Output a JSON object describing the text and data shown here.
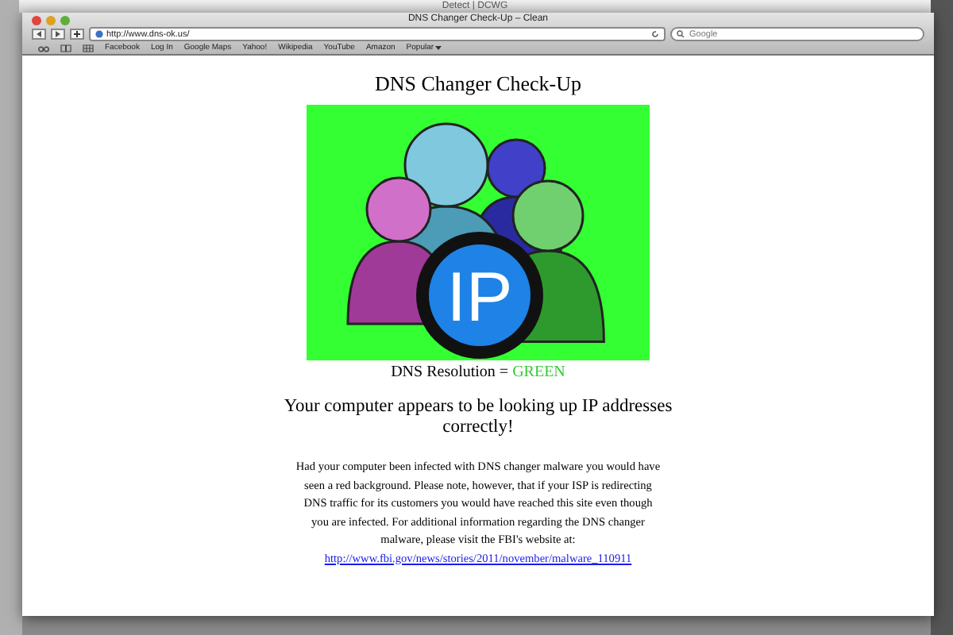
{
  "background_window": {
    "title": "Detect | DCWG"
  },
  "window": {
    "title": "DNS Changer Check-Up – Clean"
  },
  "toolbar": {
    "url": "http://www.dns-ok.us/",
    "search": {
      "placeholder": "Google"
    }
  },
  "bookmarks": [
    {
      "label": "Facebook",
      "kind": "link"
    },
    {
      "label": "Log In",
      "kind": "link"
    },
    {
      "label": "Google Maps",
      "kind": "link"
    },
    {
      "label": "Yahoo!",
      "kind": "link"
    },
    {
      "label": "Wikipedia",
      "kind": "link"
    },
    {
      "label": "YouTube",
      "kind": "link"
    },
    {
      "label": "Amazon",
      "kind": "link"
    },
    {
      "label": "Popular",
      "kind": "menu"
    }
  ],
  "page": {
    "heading": "DNS Changer Check-Up",
    "illustration_label": "IP",
    "result": {
      "label": "DNS Resolution = ",
      "value": "GREEN"
    },
    "message": "Your computer appears to be looking up IP addresses correctly!",
    "paragraph": "Had your computer been infected with DNS changer malware you would have seen a red background.  Please note, however, that if your ISP is redirecting DNS traffic for its customers you would have reached this site even though you are infected. For additional information regarding the DNS changer malware, please visit the FBI's website at:",
    "link": "http://www.fbi.gov/news/stories/2011/november/malware_110911"
  }
}
